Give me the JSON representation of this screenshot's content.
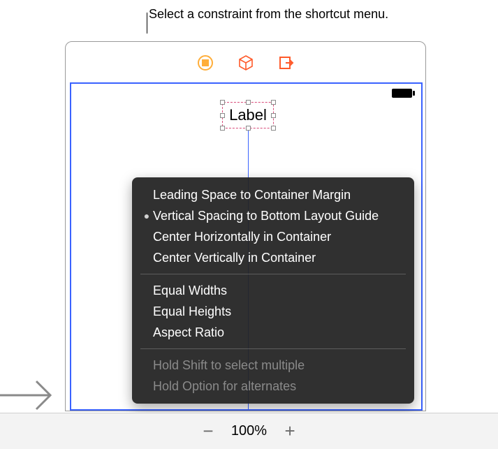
{
  "caption": "Select a constraint from the shortcut menu.",
  "label_text": "Label",
  "menu": {
    "group1": [
      {
        "label": "Leading Space to Container Margin",
        "selected": false
      },
      {
        "label": "Vertical Spacing to Bottom Layout Guide",
        "selected": true
      },
      {
        "label": "Center Horizontally in Container",
        "selected": false
      },
      {
        "label": "Center Vertically in Container",
        "selected": false
      }
    ],
    "group2": [
      {
        "label": "Equal Widths"
      },
      {
        "label": "Equal Heights"
      },
      {
        "label": "Aspect Ratio"
      }
    ],
    "hints": [
      "Hold Shift to select multiple",
      "Hold Option for alternates"
    ]
  },
  "zoom": {
    "minus": "−",
    "plus": "+",
    "level": "100%"
  },
  "icons": {
    "chip": "chip-icon",
    "cube": "cube-icon",
    "box": "box-icon"
  }
}
